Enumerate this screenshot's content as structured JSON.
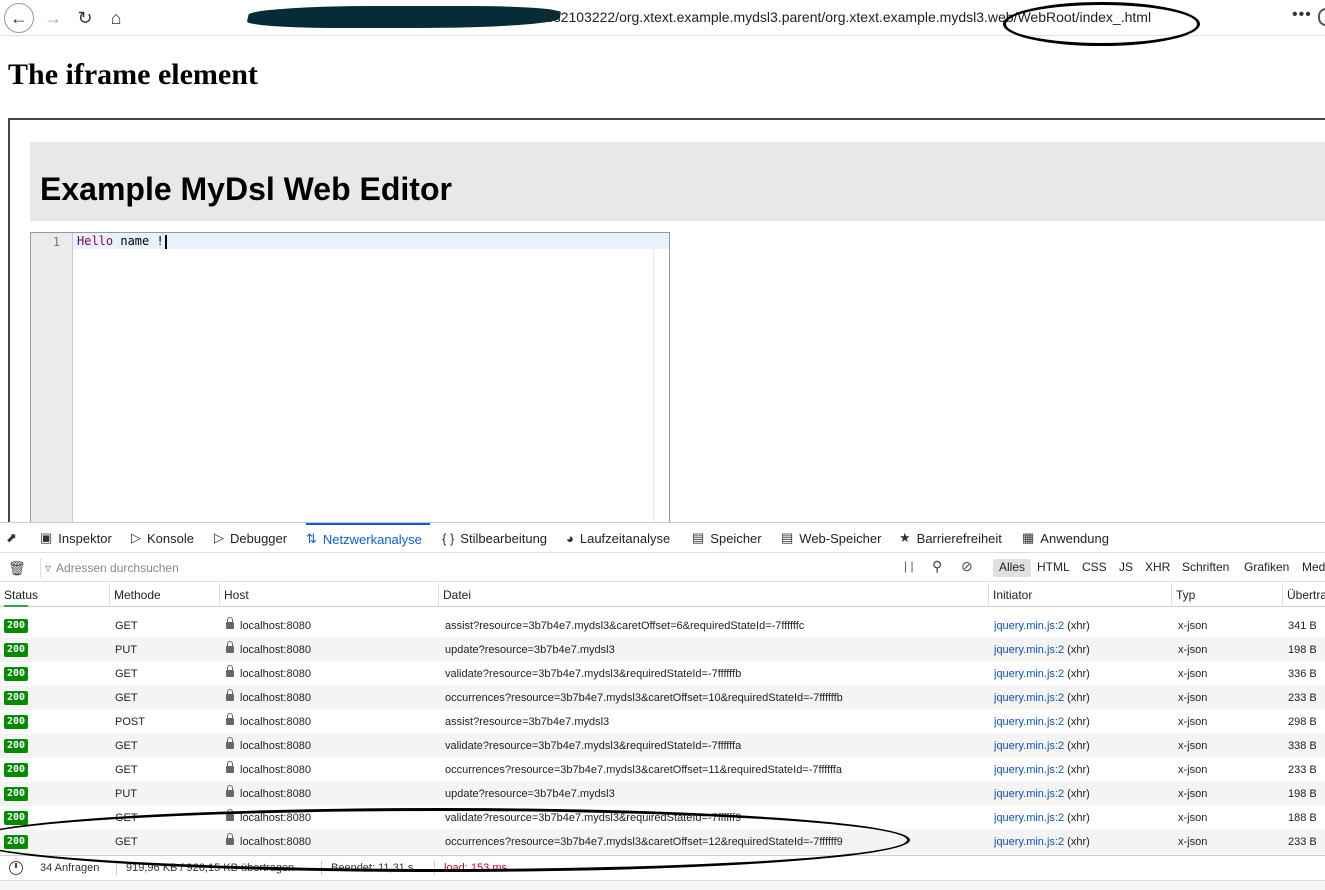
{
  "toolbar": {
    "url": "/es2103222/org.xtext.example.mydsl3.parent/org.xtext.example.mydsl3.web/WebRoot/index_.html",
    "menu_glyph": "•••"
  },
  "page": {
    "title": "The iframe element",
    "editor_title": "Example MyDsl Web Editor",
    "line_number": "1",
    "code_keyword": "Hello",
    "code_rest": " name !"
  },
  "devtools": {
    "tabs": [
      {
        "icon": "inspector-icon",
        "label": "Inspektor"
      },
      {
        "icon": "console-icon",
        "label": "Konsole"
      },
      {
        "icon": "debugger-icon",
        "label": "Debugger"
      },
      {
        "icon": "network-icon",
        "label": "Netzwerkanalyse"
      },
      {
        "icon": "style-editor-icon",
        "label": "Stilbearbeitung"
      },
      {
        "icon": "performance-icon",
        "label": "Laufzeitanalyse"
      },
      {
        "icon": "storage-icon",
        "label": "Speicher"
      },
      {
        "icon": "web-storage-icon",
        "label": "Web-Speicher"
      },
      {
        "icon": "accessibility-icon",
        "label": "Barrierefreiheit"
      },
      {
        "icon": "application-icon",
        "label": "Anwendung"
      }
    ],
    "active_tab": "Netzwerkanalyse",
    "filter_placeholder": "Adressen durchsuchen",
    "filter_types": [
      "Alles",
      "HTML",
      "CSS",
      "JS",
      "XHR",
      "Schriften",
      "Grafiken",
      "Med"
    ],
    "columns": [
      "Status",
      "Methode",
      "Host",
      "Datei",
      "Initiator",
      "Typ",
      "Übertra"
    ],
    "rows": [
      {
        "status": "200",
        "method": "GET",
        "host": "localhost:8080",
        "file": "assist?resource=3b7b4e7.mydsl3&caretOffset=6&requiredStateId=-7ffffffc",
        "initiator": "jquery.min.js:2",
        "initiator_suffix": "(xhr)",
        "type": "x-json",
        "size": "341 B"
      },
      {
        "status": "200",
        "method": "PUT",
        "host": "localhost:8080",
        "file": "update?resource=3b7b4e7.mydsl3",
        "initiator": "jquery.min.js:2",
        "initiator_suffix": "(xhr)",
        "type": "x-json",
        "size": "198 B"
      },
      {
        "status": "200",
        "method": "GET",
        "host": "localhost:8080",
        "file": "validate?resource=3b7b4e7.mydsl3&requiredStateId=-7ffffffb",
        "initiator": "jquery.min.js:2",
        "initiator_suffix": "(xhr)",
        "type": "x-json",
        "size": "336 B"
      },
      {
        "status": "200",
        "method": "GET",
        "host": "localhost:8080",
        "file": "occurrences?resource=3b7b4e7.mydsl3&caretOffset=10&requiredStateId=-7ffffffb",
        "initiator": "jquery.min.js:2",
        "initiator_suffix": "(xhr)",
        "type": "x-json",
        "size": "233 B"
      },
      {
        "status": "200",
        "method": "POST",
        "host": "localhost:8080",
        "file": "assist?resource=3b7b4e7.mydsl3",
        "initiator": "jquery.min.js:2",
        "initiator_suffix": "(xhr)",
        "type": "x-json",
        "size": "298 B"
      },
      {
        "status": "200",
        "method": "GET",
        "host": "localhost:8080",
        "file": "validate?resource=3b7b4e7.mydsl3&requiredStateId=-7ffffffa",
        "initiator": "jquery.min.js:2",
        "initiator_suffix": "(xhr)",
        "type": "x-json",
        "size": "338 B"
      },
      {
        "status": "200",
        "method": "GET",
        "host": "localhost:8080",
        "file": "occurrences?resource=3b7b4e7.mydsl3&caretOffset=11&requiredStateId=-7ffffffa",
        "initiator": "jquery.min.js:2",
        "initiator_suffix": "(xhr)",
        "type": "x-json",
        "size": "233 B"
      },
      {
        "status": "200",
        "method": "PUT",
        "host": "localhost:8080",
        "file": "update?resource=3b7b4e7.mydsl3",
        "initiator": "jquery.min.js:2",
        "initiator_suffix": "(xhr)",
        "type": "x-json",
        "size": "198 B"
      },
      {
        "status": "200",
        "method": "GET",
        "host": "localhost:8080",
        "file": "validate?resource=3b7b4e7.mydsl3&requiredStateId=-7ffffff9",
        "initiator": "jquery.min.js:2",
        "initiator_suffix": "(xhr)",
        "type": "x-json",
        "size": "188 B"
      },
      {
        "status": "200",
        "method": "GET",
        "host": "localhost:8080",
        "file": "occurrences?resource=3b7b4e7.mydsl3&caretOffset=12&requiredStateId=-7ffffff9",
        "initiator": "jquery.min.js:2",
        "initiator_suffix": "(xhr)",
        "type": "x-json",
        "size": "233 B"
      }
    ],
    "statusbar": {
      "requests": "34 Anfragen",
      "transferred": "919,96 KB / 926,15 KB übertragen",
      "finish": "Beendet: 11,31 s",
      "load": "load: 153 ms"
    }
  },
  "colors": {
    "accent": "#0a5ed9",
    "status_ok": "#058b00",
    "load_text": "#d70022"
  }
}
